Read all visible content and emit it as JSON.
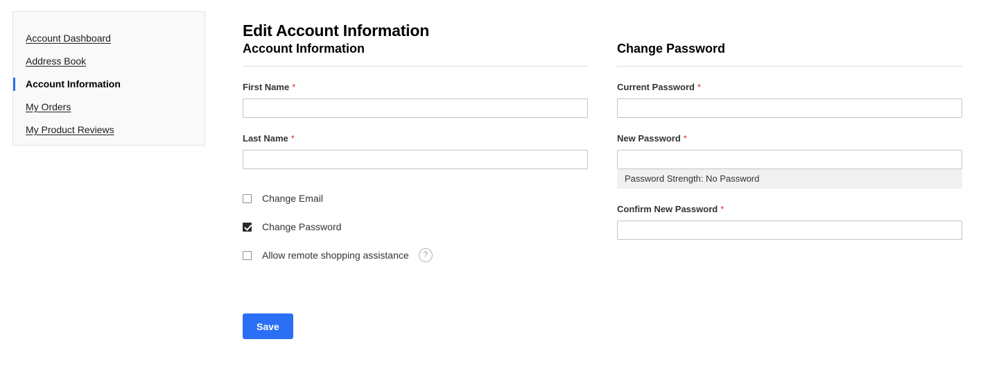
{
  "page": {
    "title": "Edit Account Information"
  },
  "sidebar": {
    "items": [
      {
        "label": "Account Dashboard",
        "current": false
      },
      {
        "label": "Address Book",
        "current": false
      },
      {
        "label": "Account Information",
        "current": true
      },
      {
        "label": "My Orders",
        "current": false
      },
      {
        "label": "My Product Reviews",
        "current": false
      }
    ]
  },
  "account_information": {
    "section_title": "Account Information",
    "first_name": {
      "label": "First Name",
      "required_marker": "*",
      "value": "",
      "placeholder": ""
    },
    "last_name": {
      "label": "Last Name",
      "required_marker": "*",
      "value": "",
      "placeholder": ""
    },
    "checkboxes": [
      {
        "label": "Change Email",
        "checked": false,
        "help": false
      },
      {
        "label": "Change Password",
        "checked": true,
        "help": false
      },
      {
        "label": "Allow remote shopping assistance",
        "checked": false,
        "help": true,
        "help_glyph": "?"
      }
    ]
  },
  "change_password": {
    "section_title": "Change Password",
    "current_password": {
      "label": "Current Password",
      "required_marker": "*",
      "value": "",
      "placeholder": ""
    },
    "new_password": {
      "label": "New Password",
      "required_marker": "*",
      "value": "",
      "placeholder": ""
    },
    "password_strength": "Password Strength: No Password",
    "confirm_new_password": {
      "label": "Confirm New Password",
      "required_marker": "*",
      "value": "",
      "placeholder": ""
    }
  },
  "actions": {
    "save_label": "Save"
  },
  "colors": {
    "accent": "#2b6ff5",
    "required": "#e02b27",
    "meter_background": "#f1f1f1",
    "sidebar_background": "#f9f9f9"
  }
}
